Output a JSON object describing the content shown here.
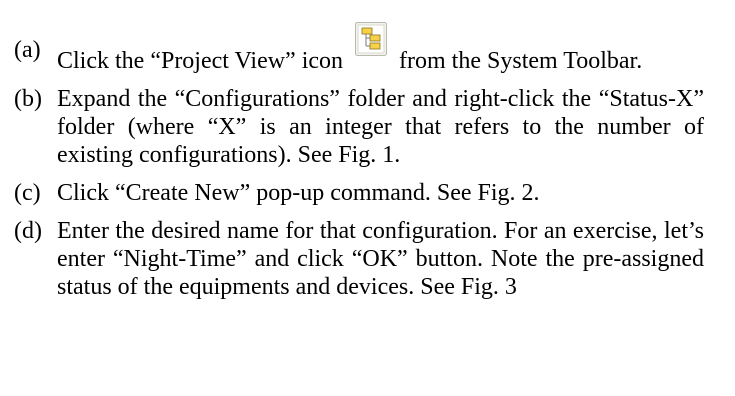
{
  "steps": [
    {
      "label": "(a)",
      "text_before": "Click the “Project View” icon",
      "icon": "project-view-icon",
      "text_after": "from the System Toolbar."
    },
    {
      "label": "(b)",
      "text": "Expand the “Configurations” folder and right-click the “Status-X” folder (where “X” is an integer that refers to the number of existing configurations).  See Fig. 1."
    },
    {
      "label": "(c)",
      "text": "Click “Create New” pop-up command.  See Fig. 2."
    },
    {
      "label": "(d)",
      "text": "Enter the desired name for that configuration.  For an exercise, let’s enter “Night-Time” and click “OK” button.  Note the pre-assigned status of the equipments and devices.  See Fig. 3"
    }
  ]
}
